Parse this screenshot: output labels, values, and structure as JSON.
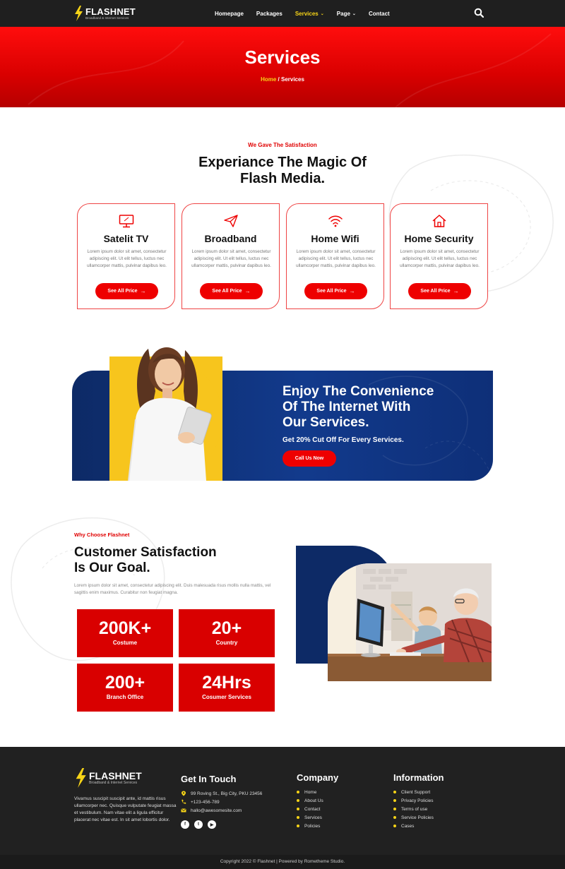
{
  "nav": {
    "brand": "FLASHNET",
    "tagline": "Broadband & Internet Services",
    "items": [
      {
        "label": "Homepage"
      },
      {
        "label": "Packages"
      },
      {
        "label": "Services"
      },
      {
        "label": "Page"
      },
      {
        "label": "Contact"
      }
    ],
    "search_icon": "search-icon"
  },
  "hero": {
    "title": "Services",
    "breadcrumb_home": "Home",
    "breadcrumb_sep": " / ",
    "breadcrumb_current": "Services"
  },
  "services": {
    "kicker": "We Gave The Satisfaction",
    "title_line1": "Experiance The Magic Of",
    "title_line2": "Flash Media.",
    "cards": [
      {
        "title": "Satelit TV",
        "icon": "monitor-icon",
        "desc": "Lorem ipsum dolor sit amet, consectetur adipiscing elit. Ut elit tellus, luctus nec ullamcorper mattis, pulvinar dapibus leo.",
        "button": "See All Price"
      },
      {
        "title": "Broadband",
        "icon": "paper-plane-icon",
        "desc": "Lorem ipsum dolor sit amet, consectetur adipiscing elit. Ut elit tellus, luctus nec ullamcorper mattis, pulvinar dapibus leo.",
        "button": "See All Price"
      },
      {
        "title": "Home Wifi",
        "icon": "wifi-icon",
        "desc": "Lorem ipsum dolor sit amet, consectetur adipiscing elit. Ut elit tellus, luctus nec ullamcorper mattis, pulvinar dapibus leo.",
        "button": "See All Price"
      },
      {
        "title": "Home Security",
        "icon": "home-icon",
        "desc": "Lorem ipsum dolor sit amet, consectetur adipiscing elit. Ut elit tellus, luctus nec ullamcorper mattis, pulvinar dapibus leo.",
        "button": "See All Price"
      }
    ]
  },
  "banner": {
    "title_line1": "Enjoy The Convenience",
    "title_line2": "Of The Internet With",
    "title_line3": "Our Services.",
    "subtitle": "Get 20% Cut Off For Every Services.",
    "button": "Call Us Now"
  },
  "why": {
    "kicker": "Why Choose Flashnet",
    "title_line1": "Customer Satisfaction",
    "title_line2": "Is Our Goal.",
    "desc": "Lorem ipsum dolor sit amet, consectetur adipiscing elit. Duis malesuada risus mollis nulla mattis, vel sagittis enim maximus. Curabitur non feugiat magna.",
    "stats": [
      {
        "value": "200K+",
        "label": "Costume"
      },
      {
        "value": "20+",
        "label": "Country"
      },
      {
        "value": "200+",
        "label": "Branch Office"
      },
      {
        "value": "24Hrs",
        "label": "Cosumer Services"
      }
    ]
  },
  "footer": {
    "brand": "FLASHNET",
    "tagline": "Broadband & Internet Services",
    "about": "Vivamus suscipit suscipit ante, id mattis risus ullamcorper nec. Quisque vulputate feugiat massa et vestibulum. Nam vitae elit a ligula efficitur placerat nec vitae est. In sit amet lobortis dolor.",
    "contact_title": "Get In Touch",
    "address": "99 Roving St., Big City, PKU 23456",
    "phone": "+123-456-789",
    "email": "hallo@awesomesite.com",
    "company_title": "Company",
    "company_links": [
      "Home",
      "About Us",
      "Contact",
      "Services",
      "Policies"
    ],
    "info_title": "Information",
    "info_links": [
      "Client Support",
      "Privacy Policies",
      "Terms of use",
      "Service Policies",
      "Cases"
    ],
    "copyright": "Copyright 2022 © Flashnet | Powered by Rometheme Studio."
  },
  "colors": {
    "accent": "#ee0000",
    "navy": "#0d2a66",
    "yellow": "#f7d417",
    "dark": "#212121"
  }
}
